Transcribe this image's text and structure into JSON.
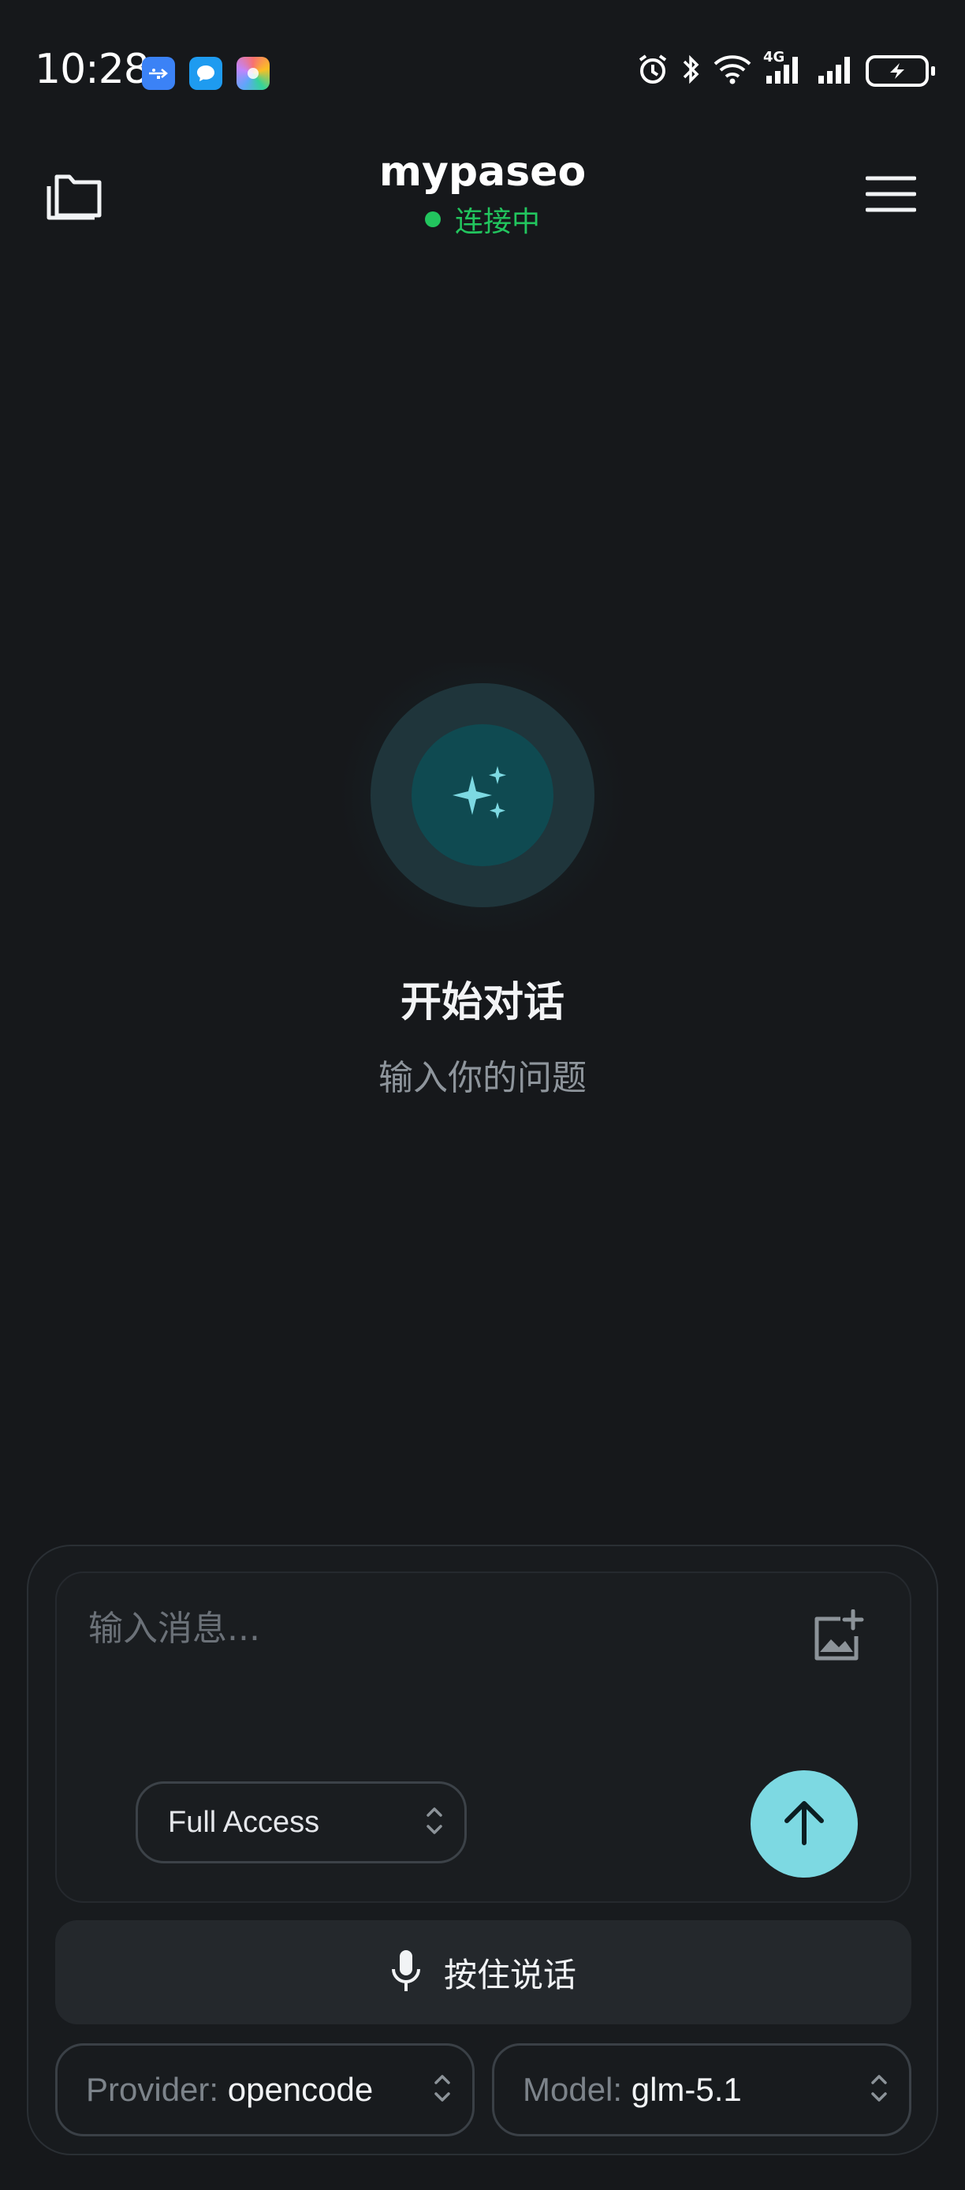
{
  "status_bar": {
    "time": "10:28",
    "notifications": [
      "usb-icon",
      "message-icon",
      "app-icon"
    ],
    "indicators": [
      "alarm-icon",
      "bluetooth-icon",
      "wifi-icon",
      "4g-signal-icon",
      "signal-icon",
      "battery-charging-icon"
    ],
    "network_label": "4G"
  },
  "header": {
    "title": "mypaseo",
    "status_text": "连接中",
    "status_color": "#22c55e",
    "left_icon": "folder-icon",
    "right_icon": "menu-icon"
  },
  "empty_state": {
    "icon": "sparkles-icon",
    "title": "开始对话",
    "subtitle": "输入你的问题"
  },
  "composer": {
    "placeholder": "输入消息...",
    "attach_icon": "image-add-icon",
    "access_mode": "Full Access",
    "send_icon": "arrow-up-icon",
    "voice_label": "按住说话",
    "provider_key": "Provider: ",
    "provider_value": "opencode",
    "model_key": "Model: ",
    "model_value": "glm-5.1"
  },
  "colors": {
    "background": "#16181b",
    "accent": "#7dd9e2",
    "connected": "#22c55e"
  }
}
